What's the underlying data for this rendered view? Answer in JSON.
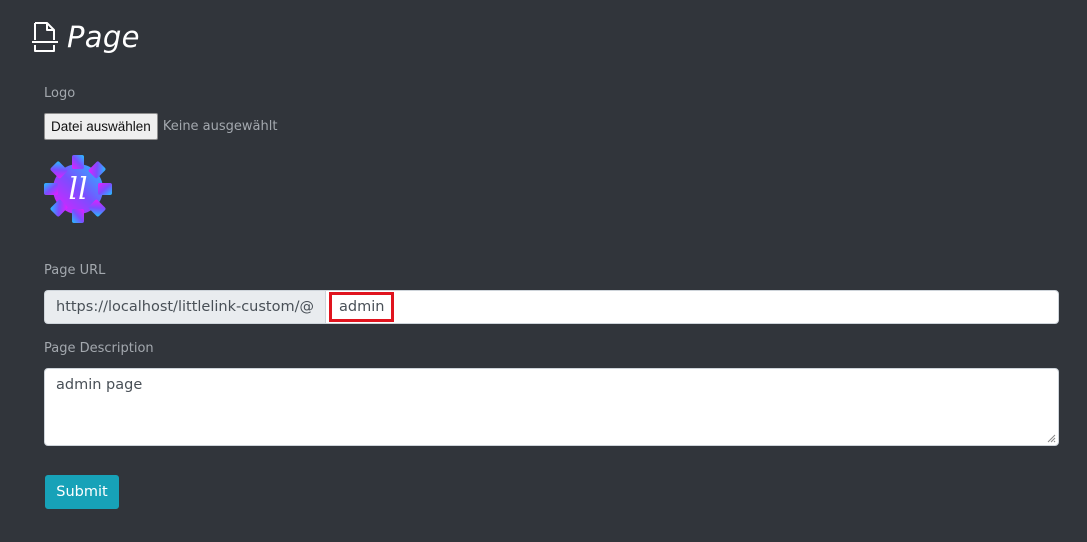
{
  "header": {
    "title": "Page",
    "icon": "document-icon"
  },
  "logo_field": {
    "label": "Logo",
    "file_button_label": "Datei auswählen",
    "file_status": "Keine ausgewählt",
    "preview_text": "ll",
    "preview_icon": "gear-logo-icon"
  },
  "url_field": {
    "label": "Page URL",
    "prefix": "https://localhost/littlelink-custom/@",
    "value": "admin"
  },
  "description_field": {
    "label": "Page Description",
    "value": "admin page"
  },
  "submit": {
    "label": "Submit"
  },
  "colors": {
    "background": "#31353b",
    "accent": "#17a2b8",
    "highlight": "#e0141e"
  }
}
